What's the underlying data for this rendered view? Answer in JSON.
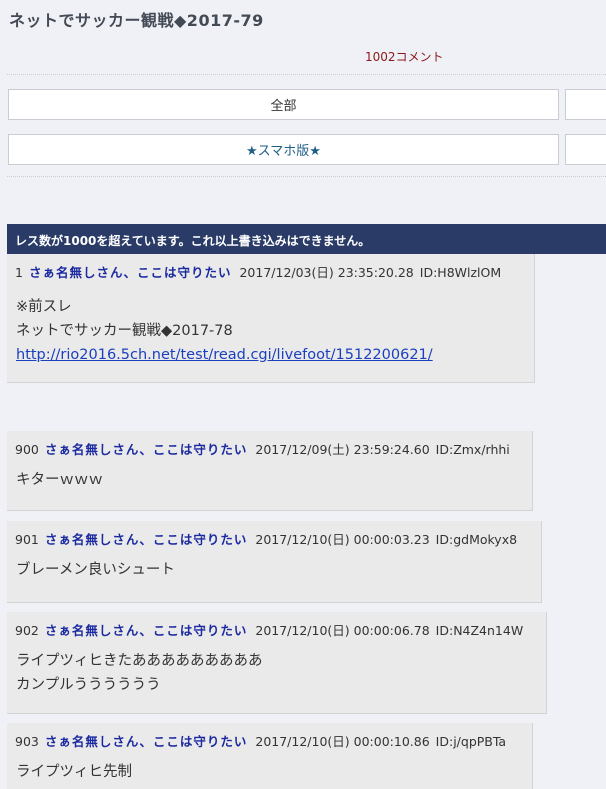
{
  "thread": {
    "title": "ネットでサッカー観戦◆2017-79",
    "comment_count": "1002コメント"
  },
  "buttons": {
    "all": "全部",
    "smartphone": "★スマホ版★"
  },
  "notice": "レス数が1000を超えています。これ以上書き込みはできません。",
  "colors": {
    "banner_bg": "#2a3b67",
    "name_color": "#1b2aa0",
    "link_color": "#1a3fbf",
    "count_color": "#8b1a1a"
  },
  "posts": [
    {
      "num": "1",
      "name": "さぁ名無しさん、ここは守りたい",
      "date": "2017/12/03(日) 23:35:20.28",
      "id": "ID:H8WlzlOM",
      "lines": [
        "※前スレ",
        "ネットでサッカー観戦◆2017-78"
      ],
      "link": "http://rio2016.5ch.net/test/read.cgi/livefoot/1512200621/"
    },
    {
      "num": "900",
      "name": "さぁ名無しさん、ここは守りたい",
      "date": "2017/12/09(土) 23:59:24.60",
      "id": "ID:Zmx/rhhi",
      "lines": [
        "キターｗｗｗ"
      ]
    },
    {
      "num": "901",
      "name": "さぁ名無しさん、ここは守りたい",
      "date": "2017/12/10(日) 00:00:03.23",
      "id": "ID:gdMokyx8",
      "lines": [
        "ブレーメン良いシュート"
      ]
    },
    {
      "num": "902",
      "name": "さぁ名無しさん、ここは守りたい",
      "date": "2017/12/10(日) 00:00:06.78",
      "id": "ID:N4Z4n14W",
      "lines": [
        "ライプツィヒきたあああああああああ",
        "カンプルうううううう"
      ]
    },
    {
      "num": "903",
      "name": "さぁ名無しさん、ここは守りたい",
      "date": "2017/12/10(日) 00:00:10.86",
      "id": "ID:j/qpPBTa",
      "lines": [
        "ライプツィヒ先制"
      ]
    }
  ]
}
